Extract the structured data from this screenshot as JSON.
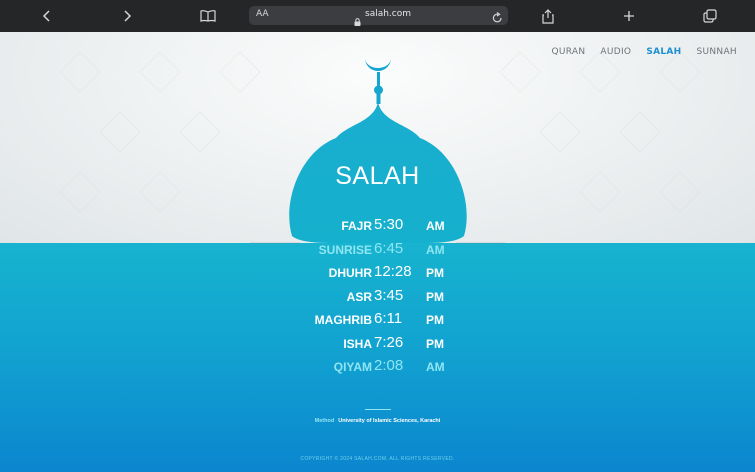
{
  "browser": {
    "text_size_label": "AA",
    "domain": "salah.com"
  },
  "nav": {
    "items": [
      {
        "label": "QURAN"
      },
      {
        "label": "AUDIO"
      },
      {
        "label": "SALAH"
      },
      {
        "label": "SUNNAH"
      }
    ],
    "active": "SALAH"
  },
  "hero": {
    "title": "SALAH"
  },
  "prayers": [
    {
      "name": "FAJR",
      "time": "5:30",
      "ampm": "AM"
    },
    {
      "name": "SUNRISE",
      "time": "6:45",
      "ampm": "AM"
    },
    {
      "name": "DHUHR",
      "time": "12:28",
      "ampm": "PM"
    },
    {
      "name": "ASR",
      "time": "3:45",
      "ampm": "PM"
    },
    {
      "name": "MAGHRIB",
      "time": "6:11",
      "ampm": "PM"
    },
    {
      "name": "ISHA",
      "time": "7:26",
      "ampm": "PM"
    },
    {
      "name": "QIYAM",
      "time": "2:08",
      "ampm": "AM"
    }
  ],
  "method": {
    "label": "Method",
    "value": "University of Islamic Sciences, Karachi"
  },
  "footer": {
    "copyright": "COPYRIGHT © 2024 SALAH.COM. ALL RIGHTS RESERVED."
  },
  "colors": {
    "accent": "#1b8fd0",
    "teal_top": "#17b3cf",
    "blue_bottom": "#0b86cf",
    "dim_text": "#8fe6f2"
  }
}
